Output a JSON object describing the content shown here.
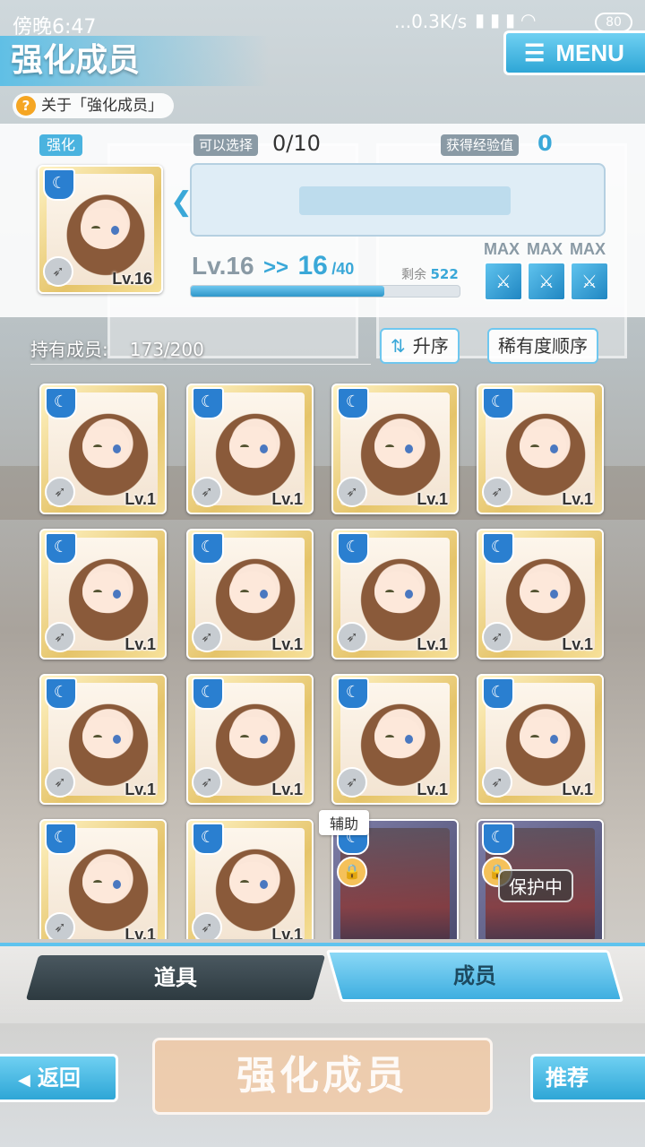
{
  "status_bar": {
    "time": "傍晚6:47",
    "network": "...0.3K/s",
    "battery": "80"
  },
  "header": {
    "title": "强化成员",
    "menu_label": "MENU",
    "about_label": "关于「強化成员」"
  },
  "panel": {
    "enhance_tag": "强化",
    "selectable_label": "可以选择",
    "selectable_value": "0/10",
    "exp_label": "获得经验值",
    "exp_value": "0",
    "current_card_level": "Lv.16",
    "level_from": "Lv.16",
    "level_arrow": ">>",
    "level_to": "16",
    "level_cap": "/40",
    "remain_label": "剩余",
    "remain_value": "522",
    "level_progress": 0.72,
    "max_labels": [
      "MAX",
      "MAX",
      "MAX"
    ]
  },
  "list": {
    "owned_label": "持有成员:",
    "owned_value": "173/200",
    "sort_order_label": "升序",
    "sort_key_label": "稀有度顺序",
    "cards": [
      {
        "level": "Lv.1"
      },
      {
        "level": "Lv.1"
      },
      {
        "level": "Lv.1"
      },
      {
        "level": "Lv.1"
      },
      {
        "level": "Lv.1"
      },
      {
        "level": "Lv.1"
      },
      {
        "level": "Lv.1"
      },
      {
        "level": "Lv.1"
      },
      {
        "level": "Lv.1"
      },
      {
        "level": "Lv.1"
      },
      {
        "level": "Lv.1"
      },
      {
        "level": "Lv.1"
      },
      {
        "level": "Lv.1"
      },
      {
        "level": "Lv.1"
      }
    ],
    "assist_tag": "辅助",
    "protect_tag": "保护中"
  },
  "tabs": {
    "items": "道具",
    "members": "成员"
  },
  "actions": {
    "back": "返回",
    "enhance": "强化成员",
    "recommend": "推荐"
  },
  "colors": {
    "accent": "#3aa8d8",
    "card_gold": "#e5c46a"
  }
}
